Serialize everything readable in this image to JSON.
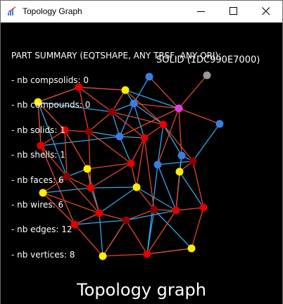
{
  "window": {
    "title": "Topology Graph",
    "icon": "app-logo-icon",
    "controls": {
      "minimize": "minimize-icon",
      "maximize": "maximize-icon",
      "close": "close-icon"
    }
  },
  "summary": {
    "heading": "PART SUMMARY (EQTSHAPE, ANY TRSF, ANY ORI):",
    "lines": [
      "- nb compsolids: 0",
      "- nb compounds: 0",
      "- nb solids: 1",
      "- nb shells: 1",
      "- nb faces: 6",
      "- nb wires: 6",
      "- nb edges: 12",
      "- nb vertices: 8"
    ]
  },
  "solid_label": "SOLID (1DC990E7000)",
  "caption": "Topology graph",
  "colors": {
    "background": "#000000",
    "vertex": "#ffee00",
    "edge": "#e00000",
    "coedge": "#8b0000",
    "wire": "#3b7de0",
    "face": "#3b7de0",
    "shell": "#e040e0",
    "solid": "#999999",
    "link_red": "#e0472f",
    "link_blue": "#35a7e8"
  }
}
